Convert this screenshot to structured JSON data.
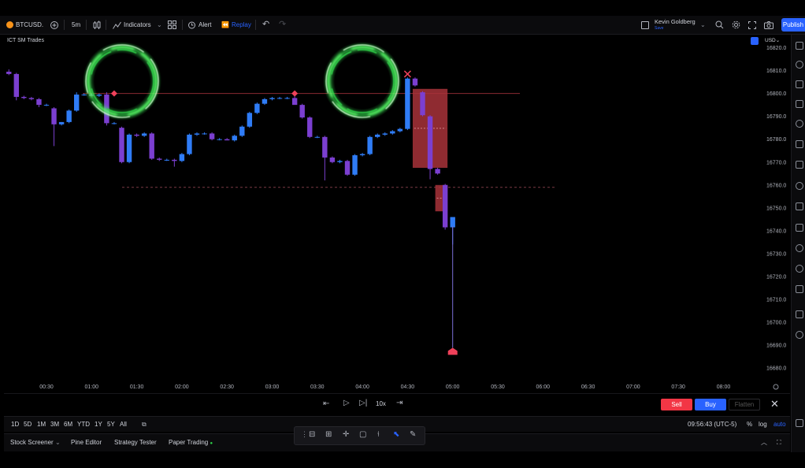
{
  "toolbar": {
    "symbol": "BTCUSD.",
    "interval": "5m",
    "indicators_label": "Indicators",
    "alert_label": "Alert",
    "replay_label": "Replay",
    "user_name": "Kevin Goldberg",
    "user_sub": "Save",
    "publish_label": "Publish"
  },
  "chart": {
    "strategy_label": "ICT SM Trades",
    "currency": "USD",
    "colors": {
      "up": "#2f7cf6",
      "down": "#7b3fd0",
      "zone": "#a8323a",
      "marker": "#f0415a"
    }
  },
  "chart_data": {
    "type": "candlestick",
    "y_ticks": [
      "16680.0",
      "16690.0",
      "16700.0",
      "16710.0",
      "16720.0",
      "16730.0",
      "16740.0",
      "16750.0",
      "16760.0",
      "16770.0",
      "16780.0",
      "16790.0",
      "16800.0",
      "16810.0",
      "16820.0"
    ],
    "x_ticks": [
      "00:30",
      "01:00",
      "01:30",
      "02:00",
      "02:30",
      "03:00",
      "03:30",
      "04:00",
      "04:30",
      "05:00",
      "05:30",
      "06:00",
      "06:30",
      "07:00",
      "07:30",
      "08:00"
    ],
    "ylim": [
      16677.5,
      16820.5
    ],
    "candles": [
      {
        "t": "00:05",
        "o": 16809.5,
        "h": 16810.5,
        "l": 16808.0,
        "c": 16808.5
      },
      {
        "t": "00:10",
        "o": 16808.5,
        "h": 16809.0,
        "l": 16797.0,
        "c": 16798.5
      },
      {
        "t": "00:15",
        "o": 16798.5,
        "h": 16799.0,
        "l": 16797.5,
        "c": 16798.0
      },
      {
        "t": "00:20",
        "o": 16798.0,
        "h": 16798.5,
        "l": 16797.0,
        "c": 16797.5
      },
      {
        "t": "00:25",
        "o": 16797.5,
        "h": 16798.0,
        "l": 16794.0,
        "c": 16795.0
      },
      {
        "t": "00:30",
        "o": 16795.0,
        "h": 16795.5,
        "l": 16794.5,
        "c": 16795.0
      },
      {
        "t": "00:35",
        "o": 16793.5,
        "h": 16794.0,
        "l": 16777.0,
        "c": 16786.5
      },
      {
        "t": "00:40",
        "o": 16786.5,
        "h": 16787.5,
        "l": 16786.0,
        "c": 16787.5
      },
      {
        "t": "00:45",
        "o": 16787.5,
        "h": 16793.0,
        "l": 16787.0,
        "c": 16792.5
      },
      {
        "t": "00:50",
        "o": 16792.5,
        "h": 16800.5,
        "l": 16792.0,
        "c": 16799.5
      },
      {
        "t": "00:55",
        "o": 16799.5,
        "h": 16800.0,
        "l": 16799.0,
        "c": 16799.5
      },
      {
        "t": "01:00",
        "o": 16799.5,
        "h": 16800.0,
        "l": 16799.0,
        "c": 16799.0
      },
      {
        "t": "01:05",
        "o": 16799.0,
        "h": 16800.0,
        "l": 16798.5,
        "c": 16799.5
      },
      {
        "t": "01:10",
        "o": 16799.5,
        "h": 16800.5,
        "l": 16786.0,
        "c": 16787.0
      },
      {
        "t": "01:15",
        "o": 16787.0,
        "h": 16787.5,
        "l": 16786.5,
        "c": 16787.0
      },
      {
        "t": "01:20",
        "o": 16785.0,
        "h": 16785.5,
        "l": 16769.5,
        "c": 16770.0
      },
      {
        "t": "01:25",
        "o": 16770.0,
        "h": 16782.5,
        "l": 16769.5,
        "c": 16782.0
      },
      {
        "t": "01:30",
        "o": 16782.0,
        "h": 16782.5,
        "l": 16781.0,
        "c": 16781.5
      },
      {
        "t": "01:35",
        "o": 16781.5,
        "h": 16783.0,
        "l": 16781.0,
        "c": 16782.5
      },
      {
        "t": "01:40",
        "o": 16782.5,
        "h": 16783.0,
        "l": 16771.0,
        "c": 16771.5
      },
      {
        "t": "01:45",
        "o": 16771.5,
        "h": 16772.0,
        "l": 16770.5,
        "c": 16771.0
      },
      {
        "t": "01:50",
        "o": 16771.0,
        "h": 16771.5,
        "l": 16770.5,
        "c": 16771.0
      },
      {
        "t": "01:55",
        "o": 16771.0,
        "h": 16771.5,
        "l": 16768.0,
        "c": 16770.5
      },
      {
        "t": "02:00",
        "o": 16770.5,
        "h": 16774.0,
        "l": 16770.0,
        "c": 16773.5
      },
      {
        "t": "02:05",
        "o": 16773.5,
        "h": 16782.5,
        "l": 16773.0,
        "c": 16782.0
      },
      {
        "t": "02:10",
        "o": 16782.0,
        "h": 16783.0,
        "l": 16781.5,
        "c": 16782.5
      },
      {
        "t": "02:15",
        "o": 16782.5,
        "h": 16783.0,
        "l": 16782.0,
        "c": 16782.5
      },
      {
        "t": "02:20",
        "o": 16782.5,
        "h": 16783.0,
        "l": 16779.5,
        "c": 16780.0
      },
      {
        "t": "02:25",
        "o": 16780.0,
        "h": 16780.5,
        "l": 16779.5,
        "c": 16780.0
      },
      {
        "t": "02:30",
        "o": 16780.0,
        "h": 16780.5,
        "l": 16779.5,
        "c": 16779.5
      },
      {
        "t": "02:35",
        "o": 16779.5,
        "h": 16782.0,
        "l": 16779.0,
        "c": 16781.5
      },
      {
        "t": "02:40",
        "o": 16781.5,
        "h": 16786.0,
        "l": 16781.0,
        "c": 16785.5
      },
      {
        "t": "02:45",
        "o": 16785.5,
        "h": 16792.0,
        "l": 16785.0,
        "c": 16791.5
      },
      {
        "t": "02:50",
        "o": 16791.5,
        "h": 16796.0,
        "l": 16791.0,
        "c": 16795.5
      },
      {
        "t": "02:55",
        "o": 16795.5,
        "h": 16798.0,
        "l": 16795.0,
        "c": 16797.5
      },
      {
        "t": "03:00",
        "o": 16797.5,
        "h": 16798.5,
        "l": 16797.0,
        "c": 16798.0
      },
      {
        "t": "03:05",
        "o": 16798.0,
        "h": 16798.5,
        "l": 16797.5,
        "c": 16798.0
      },
      {
        "t": "03:10",
        "o": 16798.0,
        "h": 16798.5,
        "l": 16797.5,
        "c": 16798.0
      },
      {
        "t": "03:15",
        "o": 16798.0,
        "h": 16800.5,
        "l": 16797.0,
        "c": 16795.0
      },
      {
        "t": "03:20",
        "o": 16795.0,
        "h": 16795.5,
        "l": 16789.0,
        "c": 16789.5
      },
      {
        "t": "03:25",
        "o": 16789.5,
        "h": 16790.0,
        "l": 16780.5,
        "c": 16781.0
      },
      {
        "t": "03:30",
        "o": 16781.0,
        "h": 16781.5,
        "l": 16780.5,
        "c": 16781.0
      },
      {
        "t": "03:35",
        "o": 16781.0,
        "h": 16781.5,
        "l": 16762.0,
        "c": 16772.0
      },
      {
        "t": "03:40",
        "o": 16772.0,
        "h": 16772.5,
        "l": 16769.5,
        "c": 16770.0
      },
      {
        "t": "03:45",
        "o": 16770.0,
        "h": 16771.0,
        "l": 16769.5,
        "c": 16770.5
      },
      {
        "t": "03:50",
        "o": 16770.5,
        "h": 16771.0,
        "l": 16764.0,
        "c": 16764.5
      },
      {
        "t": "03:55",
        "o": 16764.5,
        "h": 16773.5,
        "l": 16764.0,
        "c": 16773.0
      },
      {
        "t": "04:00",
        "o": 16773.0,
        "h": 16774.0,
        "l": 16772.5,
        "c": 16773.5
      },
      {
        "t": "04:05",
        "o": 16773.5,
        "h": 16781.5,
        "l": 16773.0,
        "c": 16781.0
      },
      {
        "t": "04:10",
        "o": 16781.0,
        "h": 16782.5,
        "l": 16780.5,
        "c": 16782.0
      },
      {
        "t": "04:15",
        "o": 16782.0,
        "h": 16783.0,
        "l": 16781.5,
        "c": 16782.5
      },
      {
        "t": "04:20",
        "o": 16782.5,
        "h": 16784.0,
        "l": 16782.0,
        "c": 16783.5
      },
      {
        "t": "04:25",
        "o": 16783.5,
        "h": 16785.0,
        "l": 16783.0,
        "c": 16784.5
      },
      {
        "t": "04:30",
        "o": 16784.5,
        "h": 16807.0,
        "l": 16784.0,
        "c": 16806.5
      },
      {
        "t": "04:35",
        "o": 16806.5,
        "h": 16807.0,
        "l": 16803.0,
        "c": 16803.5
      },
      {
        "t": "04:40",
        "o": 16800.5,
        "h": 16801.0,
        "l": 16790.0,
        "c": 16790.5
      },
      {
        "t": "04:45",
        "o": 16790.0,
        "h": 16790.5,
        "l": 16762.5,
        "c": 16767.0
      },
      {
        "t": "04:50",
        "o": 16767.0,
        "h": 16767.5,
        "l": 16764.5,
        "c": 16765.0
      },
      {
        "t": "04:55",
        "o": 16760.0,
        "h": 16760.5,
        "l": 16740.5,
        "c": 16741.5
      },
      {
        "t": "05:00",
        "o": 16741.5,
        "h": 16745.0,
        "l": 16734.0,
        "c": 16746.0
      }
    ],
    "markers": [
      {
        "t": "01:15",
        "price": 16800.0,
        "shape": "diamond"
      },
      {
        "t": "03:15",
        "price": 16800.0,
        "shape": "diamond"
      },
      {
        "t": "04:30",
        "price": 16808.5,
        "shape": "cross"
      },
      {
        "t": "05:00",
        "price": 16687.5,
        "shape": "arrow-up"
      }
    ],
    "zones": [
      {
        "t_start": "04:35",
        "t_end": "04:55",
        "top": 16802.0,
        "bottom": 16767.5
      },
      {
        "t_start": "04:50",
        "t_end": "04:55",
        "top": 16760.0,
        "bottom": 16748.5
      }
    ],
    "levels": [
      {
        "price": 16800.0,
        "style": "solid"
      },
      {
        "price": 16759.0,
        "style": "dashed"
      }
    ]
  },
  "replay": {
    "speed": "10x",
    "sell_label": "Sell",
    "buy_label": "Buy",
    "flatten_label": "Flatten"
  },
  "ranges": [
    "1D",
    "5D",
    "1M",
    "3M",
    "6M",
    "YTD",
    "1Y",
    "5Y",
    "All"
  ],
  "status": {
    "clock": "09:56:43 (UTC-5)",
    "pct": "%",
    "log": "log",
    "auto": "auto"
  },
  "panels": {
    "stock_screener": "Stock Screener",
    "pine_editor": "Pine Editor",
    "strategy_tester": "Strategy Tester",
    "paper_trading": "Paper Trading"
  }
}
